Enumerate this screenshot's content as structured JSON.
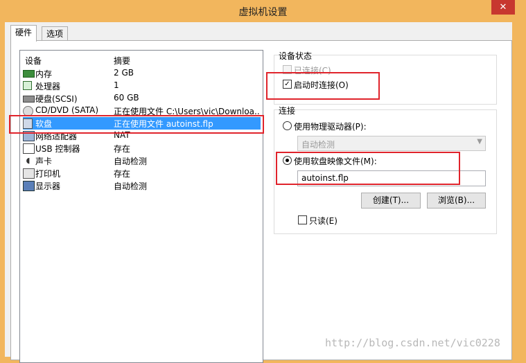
{
  "window": {
    "title": "虚拟机设置",
    "close_glyph": "✕"
  },
  "tabs": [
    {
      "label": "硬件"
    },
    {
      "label": "选项"
    }
  ],
  "device_list": {
    "col_device": "设备",
    "col_summary": "摘要",
    "rows": [
      {
        "name": "内存",
        "summary": "2 GB",
        "icon": "memory-icon"
      },
      {
        "name": "处理器",
        "summary": "1",
        "icon": "processor-icon"
      },
      {
        "name": "硬盘(SCSI)",
        "summary": "60 GB",
        "icon": "hard-disk-icon"
      },
      {
        "name": "CD/DVD (SATA)",
        "summary": "正在使用文件 C:\\Users\\vic\\Downloa...",
        "icon": "cd-dvd-icon"
      },
      {
        "name": "软盘",
        "summary": "正在使用文件 autoinst.flp",
        "icon": "floppy-icon",
        "selected": true
      },
      {
        "name": "网络适配器",
        "summary": "NAT",
        "icon": "network-adapter-icon"
      },
      {
        "name": "USB 控制器",
        "summary": "存在",
        "icon": "usb-icon"
      },
      {
        "name": "声卡",
        "summary": "自动检测",
        "icon": "sound-card-icon"
      },
      {
        "name": "打印机",
        "summary": "存在",
        "icon": "printer-icon"
      },
      {
        "name": "显示器",
        "summary": "自动检测",
        "icon": "display-icon"
      }
    ]
  },
  "device_status": {
    "group_label": "设备状态",
    "connected_label": "已连接(C)",
    "connected_checked": false,
    "connect_at_power_on_label": "启动时连接(O)",
    "connect_at_power_on_checked": true
  },
  "connection": {
    "group_label": "连接",
    "physical_drive_label": "使用物理驱动器(P):",
    "physical_drive_value": "自动检测",
    "image_file_label": "使用软盘映像文件(M):",
    "image_file_value": "autoinst.flp",
    "selected_option": "image_file",
    "create_button": "创建(T)...",
    "browse_button": "浏览(B)...",
    "read_only_label": "只读(E)",
    "read_only_checked": false
  },
  "watermark": "http://blog.csdn.net/vic0228",
  "colors": {
    "window_frame": "#f2b65d",
    "selection": "#3399ff",
    "annotation_red": "#e0232b",
    "close_button": "#c7372f"
  }
}
